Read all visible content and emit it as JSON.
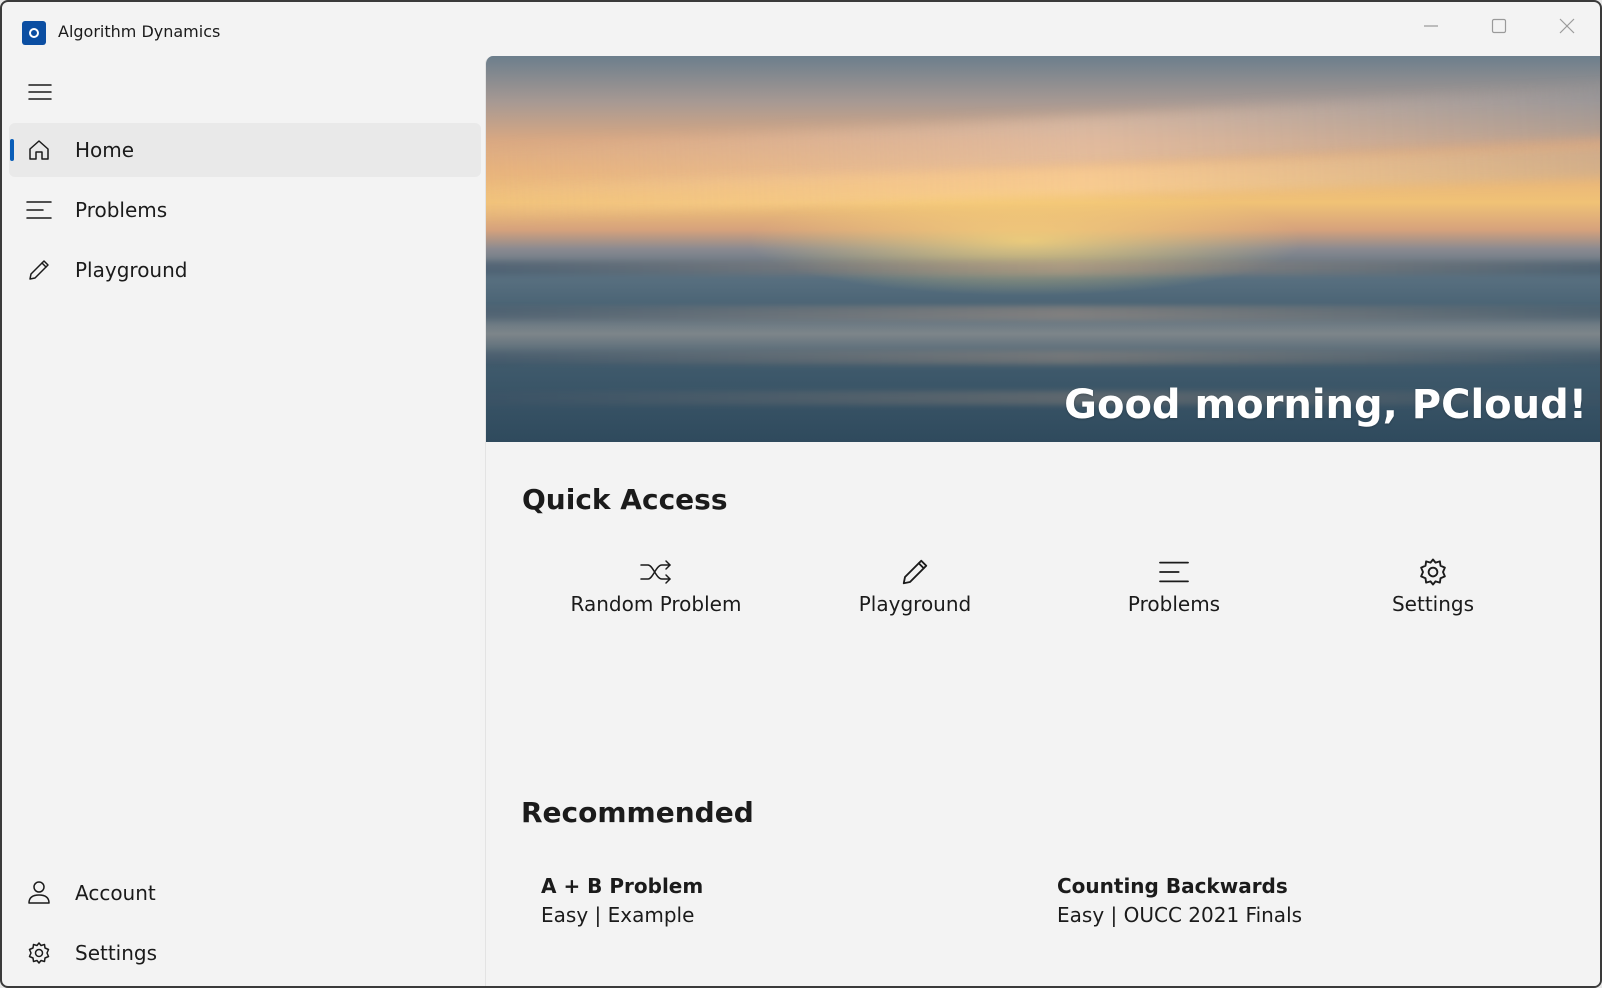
{
  "window": {
    "title": "Algorithm Dynamics",
    "app_icon": "app-logo-icon",
    "controls": [
      "minimize-icon",
      "maximize-icon",
      "close-icon"
    ]
  },
  "nav": {
    "menu_icon": "hamburger-menu-icon",
    "items": [
      {
        "label": "Home",
        "icon": "home-icon",
        "selected": true
      },
      {
        "label": "Problems",
        "icon": "list-icon",
        "selected": false
      },
      {
        "label": "Playground",
        "icon": "pencil-icon",
        "selected": false
      }
    ],
    "footer_items": [
      {
        "label": "Account",
        "icon": "person-icon"
      },
      {
        "label": "Settings",
        "icon": "gear-icon"
      }
    ]
  },
  "hero": {
    "greeting": "Good morning, PCloud!"
  },
  "quick_access": {
    "title": "Quick Access",
    "items": [
      {
        "label": "Random Problem",
        "icon": "shuffle-icon"
      },
      {
        "label": "Playground",
        "icon": "pencil-icon"
      },
      {
        "label": "Problems",
        "icon": "list-icon"
      },
      {
        "label": "Settings",
        "icon": "gear-icon"
      }
    ]
  },
  "recommended": {
    "title": "Recommended",
    "items": [
      {
        "title": "A + B Problem",
        "subtitle": "Easy | Example"
      },
      {
        "title": "Counting Backwards",
        "subtitle": "Easy | OUCC 2021 Finals"
      }
    ]
  },
  "colors": {
    "accent": "#0a5eb8",
    "app_icon_bg": "#0b4ea2",
    "background": "#f3f3f3",
    "selected_nav_bg": "#e9e9e9"
  }
}
